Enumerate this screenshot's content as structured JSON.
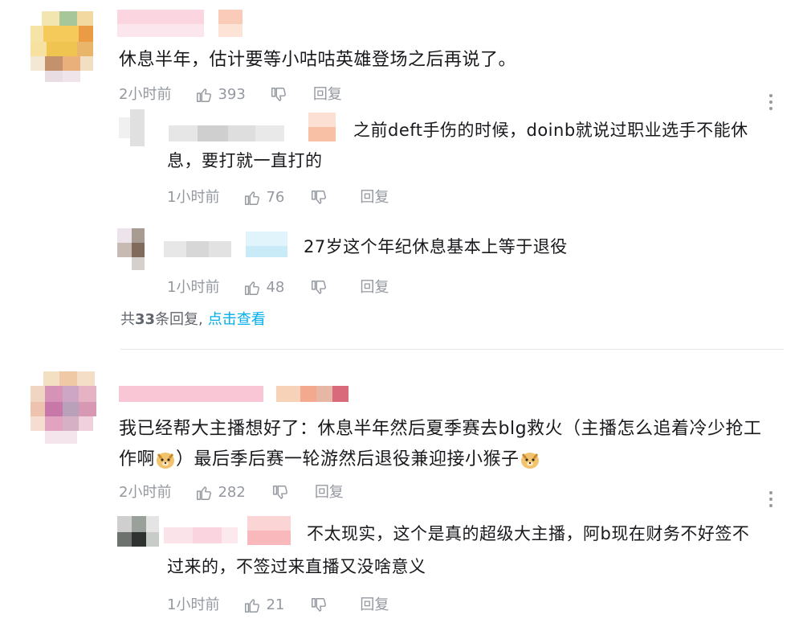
{
  "comments": [
    {
      "text": "休息半年，估计要等小咕咕英雄登场之后再说了。",
      "time": "2小时前",
      "likes": "393",
      "reply_label": "回复",
      "replies": [
        {
          "text_line1": "之前deft手伤的时候，doinb就说过职业选手不能休",
          "text_line2": "息，要打就一直打的",
          "time": "1小时前",
          "likes": "76",
          "reply_label": "回复"
        },
        {
          "text": "27岁这个年纪休息基本上等于退役",
          "time": "1小时前",
          "likes": "48",
          "reply_label": "回复"
        }
      ],
      "reply_summary_prefix": "共",
      "reply_summary_count": "33",
      "reply_summary_suffix": "条回复,",
      "reply_summary_link": "点击查看"
    },
    {
      "text_line1": "我已经帮大主播想好了：休息半年然后夏季赛去blg救火（主播怎么追着冷少抢工",
      "text_line2_a": "作啊",
      "text_line2_b": "）最后季后赛一轮游然后退役兼迎接小猴子",
      "time": "2小时前",
      "likes": "282",
      "reply_label": "回复",
      "replies": [
        {
          "text_line1": "不太现实，这个是真的超级大主播，阿b现在财务不好签不",
          "text_line2": "过来的，不签过来直播又没啥意义",
          "time": "1小时前",
          "likes": "21",
          "reply_label": "回复"
        }
      ]
    }
  ],
  "icons": {
    "like": "thumbs-up-icon",
    "dislike": "thumbs-down-icon",
    "more": "more-vertical-icon",
    "emoji": "doge-emoji-icon"
  },
  "colors": {
    "meta": "#9499a0",
    "link": "#00aeec",
    "text": "#18191c",
    "divider": "#e3e5e7"
  }
}
